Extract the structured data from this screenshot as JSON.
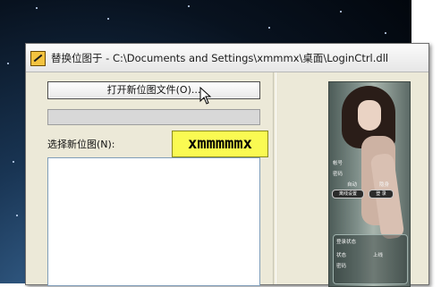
{
  "window": {
    "title": "替换位图于 - C:\\Documents and Settings\\xmmmx\\桌面\\LoginCtrl.dll",
    "open_button_label": "打开新位图文件(O)...",
    "select_label": "选择新位图(N):",
    "watermark_text": "xmmmmmx",
    "path_value": ""
  },
  "preview": {
    "labels": [
      "帐号",
      "密码",
      "自动",
      "隐身",
      "离线设置",
      "登 录",
      "登录状态",
      "状态",
      "密码",
      "上线"
    ]
  },
  "colors": {
    "window_bg": "#ece9d8",
    "watermark_bg": "#fafa52",
    "listbox_border": "#7f9db9"
  },
  "icons": [
    "app-icon",
    "mouse-cursor-icon"
  ]
}
